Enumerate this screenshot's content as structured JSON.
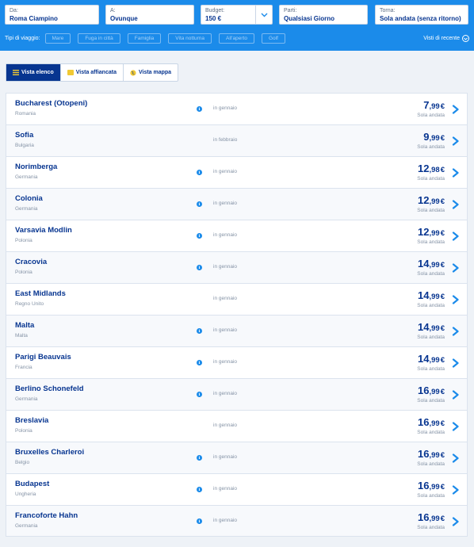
{
  "search": {
    "from": {
      "label": "Da:",
      "value": "Roma Ciampino"
    },
    "to": {
      "label": "A:",
      "value": "Ovunque"
    },
    "budget": {
      "label": "Budget:",
      "value": "150 €"
    },
    "depart": {
      "label": "Parti:",
      "value": "Qualsiasi Giorno"
    },
    "return": {
      "label": "Torna:",
      "value": "Sola andata (senza ritorno)"
    }
  },
  "trip_types": {
    "label": "Tipi di viaggio:",
    "chips": [
      "Mare",
      "Fuga in città",
      "Famiglia",
      "Vita notturna",
      "All'aperto",
      "Golf"
    ]
  },
  "recent": {
    "label": "Visti di recente"
  },
  "views": [
    {
      "label": "Vista elenco",
      "active": true
    },
    {
      "label": "Vista affiancata",
      "active": false
    },
    {
      "label": "Vista mappa",
      "active": false
    }
  ],
  "results": [
    {
      "dest": "Bucharest (Otopeni)",
      "country": "Romania",
      "info": true,
      "month": "in gennaio",
      "price_int": "7",
      "price_dec": ",99",
      "currency": "€",
      "fare": "Sola andata"
    },
    {
      "dest": "Sofia",
      "country": "Bulgaria",
      "info": false,
      "month": "in febbraio",
      "price_int": "9",
      "price_dec": ",99",
      "currency": "€",
      "fare": "Sola andata"
    },
    {
      "dest": "Norimberga",
      "country": "Germania",
      "info": true,
      "month": "in gennaio",
      "price_int": "12",
      "price_dec": ",98",
      "currency": "€",
      "fare": "Sola andata"
    },
    {
      "dest": "Colonia",
      "country": "Germania",
      "info": true,
      "month": "in gennaio",
      "price_int": "12",
      "price_dec": ",99",
      "currency": "€",
      "fare": "Sola andata"
    },
    {
      "dest": "Varsavia Modlin",
      "country": "Polonia",
      "info": true,
      "month": "in gennaio",
      "price_int": "12",
      "price_dec": ",99",
      "currency": "€",
      "fare": "Sola andata"
    },
    {
      "dest": "Cracovia",
      "country": "Polonia",
      "info": true,
      "month": "in gennaio",
      "price_int": "14",
      "price_dec": ",99",
      "currency": "€",
      "fare": "Sola andata"
    },
    {
      "dest": "East Midlands",
      "country": "Regno Unito",
      "info": false,
      "month": "in gennaio",
      "price_int": "14",
      "price_dec": ",99",
      "currency": "€",
      "fare": "Sola andata"
    },
    {
      "dest": "Malta",
      "country": "Malta",
      "info": true,
      "month": "in gennaio",
      "price_int": "14",
      "price_dec": ",99",
      "currency": "€",
      "fare": "Sola andata"
    },
    {
      "dest": "Parigi Beauvais",
      "country": "Francia",
      "info": true,
      "month": "in gennaio",
      "price_int": "14",
      "price_dec": ",99",
      "currency": "€",
      "fare": "Sola andata"
    },
    {
      "dest": "Berlino Schonefeld",
      "country": "Germania",
      "info": true,
      "month": "in gennaio",
      "price_int": "16",
      "price_dec": ",99",
      "currency": "€",
      "fare": "Sola andata"
    },
    {
      "dest": "Breslavia",
      "country": "Polonia",
      "info": false,
      "month": "in gennaio",
      "price_int": "16",
      "price_dec": ",99",
      "currency": "€",
      "fare": "Sola andata"
    },
    {
      "dest": "Bruxelles Charleroi",
      "country": "Belgio",
      "info": true,
      "month": "in gennaio",
      "price_int": "16",
      "price_dec": ",99",
      "currency": "€",
      "fare": "Sola andata"
    },
    {
      "dest": "Budapest",
      "country": "Ungheria",
      "info": true,
      "month": "in gennaio",
      "price_int": "16",
      "price_dec": ",99",
      "currency": "€",
      "fare": "Sola andata"
    },
    {
      "dest": "Francoforte Hahn",
      "country": "Germania",
      "info": true,
      "month": "in gennaio",
      "price_int": "16",
      "price_dec": ",99",
      "currency": "€",
      "fare": "Sola andata"
    }
  ],
  "colors": {
    "header_bg": "#1b8bea",
    "brand_navy": "#073590",
    "accent_yellow": "#f1c933"
  }
}
